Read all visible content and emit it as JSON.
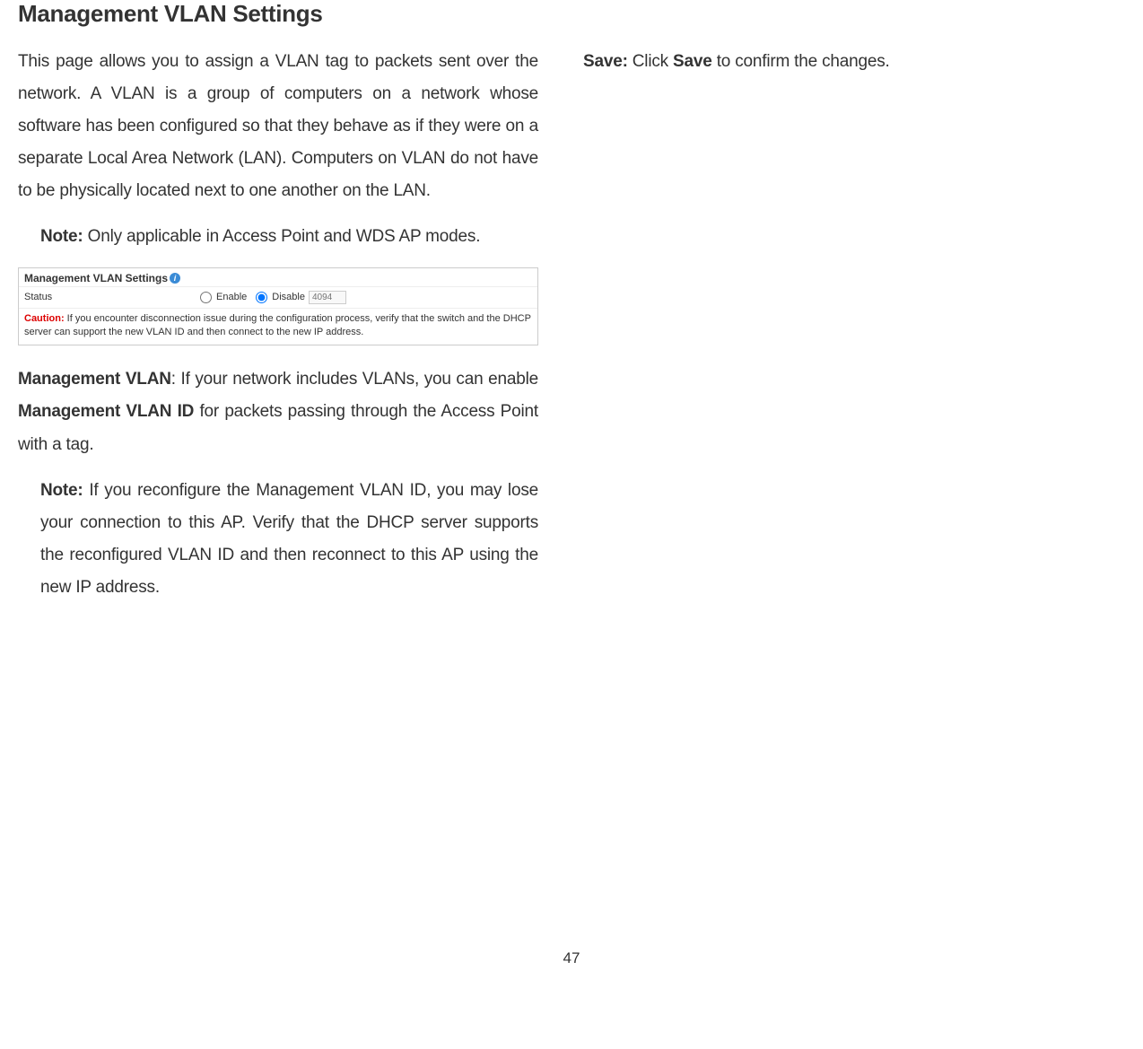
{
  "heading": "Management VLAN Settings",
  "left": {
    "intro": "This page allows you to assign a VLAN tag to packets sent over the network. A VLAN is a group of computers on a network whose software has been configured so that they behave as if they were on a separate Local Area Network (LAN). Computers on VLAN do not have to be physically located next to one another on the LAN.",
    "note1_label": "Note:",
    "note1_text": " Only applicable in Access Point and WDS AP modes.",
    "mgmt_vlan_label": "Management VLAN",
    "mgmt_vlan_text_before": ": If your network includes VLANs, you can enable ",
    "mgmt_vlan_id_bold": "Management VLAN ID",
    "mgmt_vlan_text_after": " for packets passing through the Access Point with a tag.",
    "note2_label": "Note:",
    "note2_text": " If you reconfigure the Management VLAN ID, you may lose your connection to this AP. Verify that the DHCP server supports the reconfigured VLAN ID and then reconnect to this AP using the new IP address."
  },
  "right": {
    "save_label": "Save:",
    "save_text_before": " Click ",
    "save_bold": "Save",
    "save_text_after": " to confirm the changes."
  },
  "widget": {
    "title": "Management VLAN Settings",
    "status_label": "Status",
    "enable_label": "Enable",
    "disable_label": "Disable",
    "vlan_id_placeholder": "4094",
    "caution_label": "Caution:",
    "caution_text": "   If you encounter disconnection issue during the configuration process, verify that the switch and the DHCP server can support the new VLAN ID and then connect to the new IP address."
  },
  "page_number": "47"
}
